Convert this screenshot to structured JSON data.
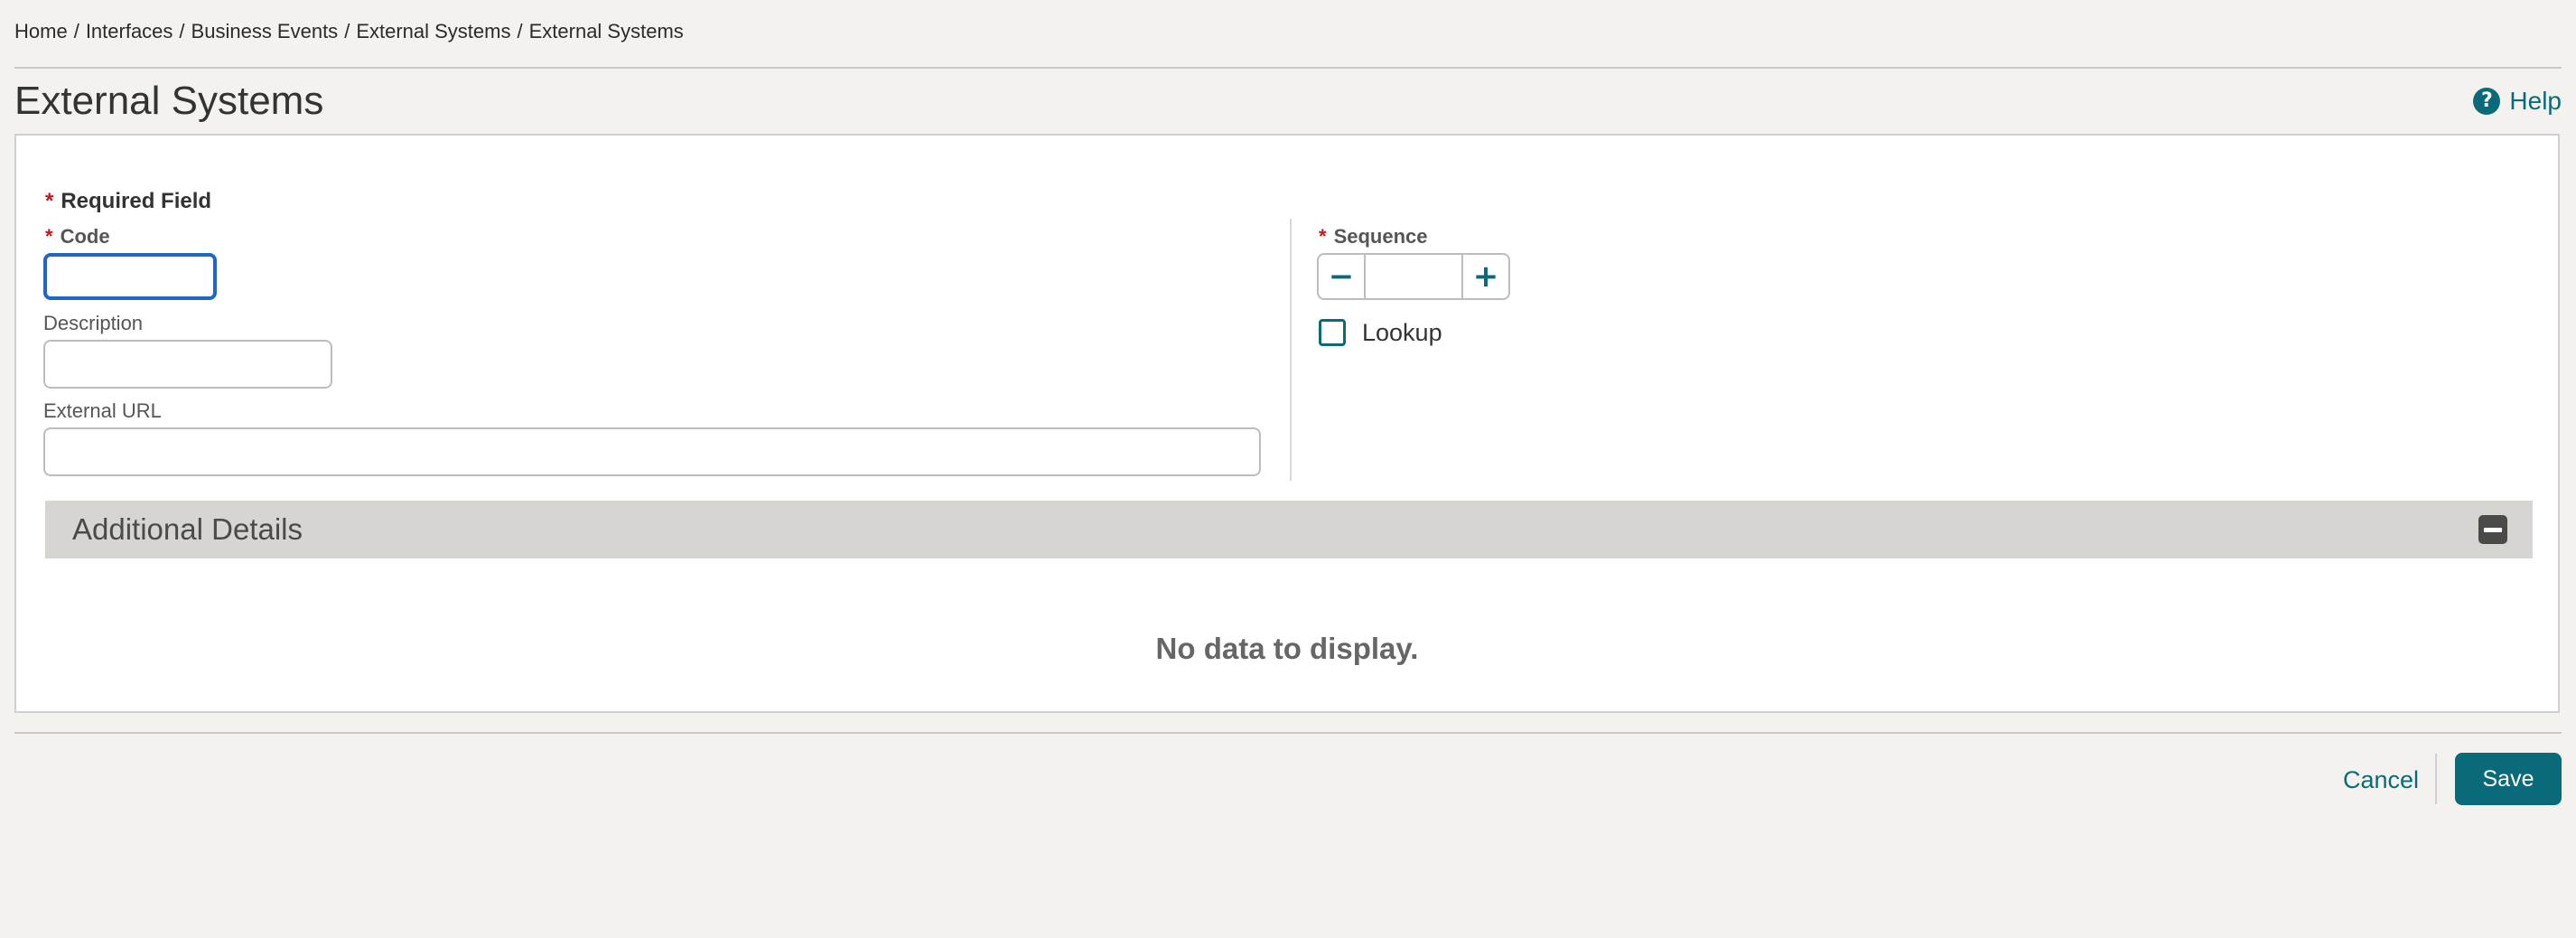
{
  "breadcrumb": [
    "Home",
    "Interfaces",
    "Business Events",
    "External Systems",
    "External Systems"
  ],
  "page": {
    "title": "External Systems",
    "help_label": "Help"
  },
  "form": {
    "required_legend": "Required Field",
    "code": {
      "label": "Code",
      "value": ""
    },
    "description": {
      "label": "Description",
      "value": ""
    },
    "external_url": {
      "label": "External URL",
      "value": ""
    },
    "sequence": {
      "label": "Sequence",
      "value": ""
    },
    "lookup": {
      "label": "Lookup",
      "checked": false
    }
  },
  "additional_details": {
    "title": "Additional Details",
    "empty_message": "No data to display."
  },
  "footer": {
    "cancel_label": "Cancel",
    "save_label": "Save"
  },
  "colors": {
    "accent": "#0a6a7a",
    "required": "#d0121b",
    "focus": "#1f66c9",
    "background": "#f3f2ef"
  },
  "icons": {
    "help": "help-circle-icon",
    "minus": "minus-icon",
    "plus": "plus-icon",
    "collapse": "collapse-icon"
  }
}
